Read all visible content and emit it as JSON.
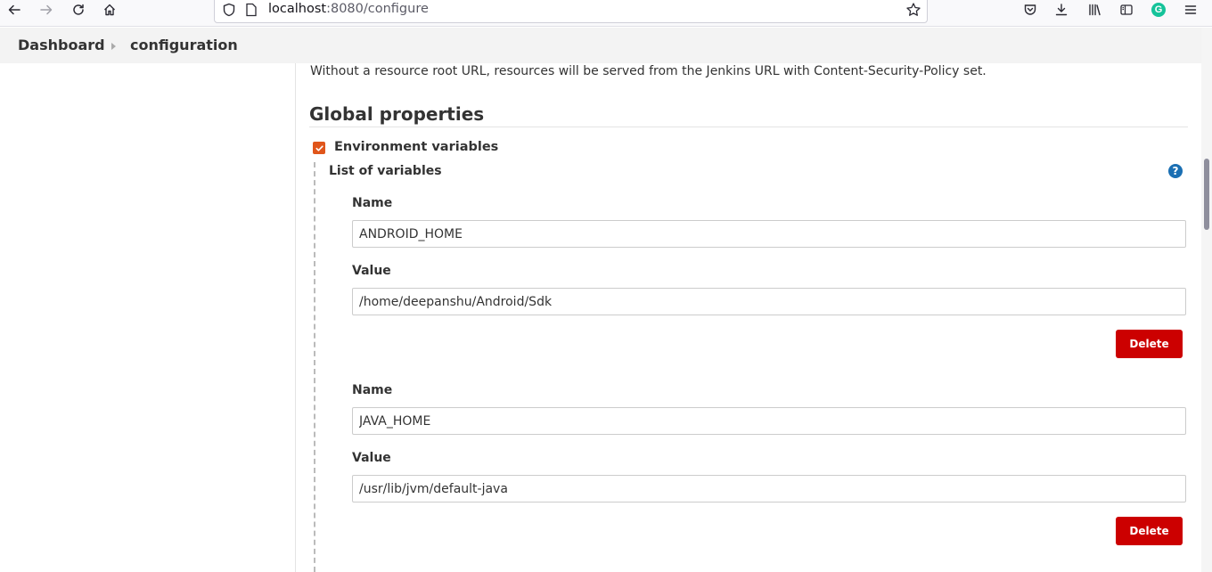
{
  "browser": {
    "url_host": "localhost",
    "url_rest": ":8080/configure"
  },
  "breadcrumb": {
    "items": [
      "Dashboard",
      "configuration"
    ]
  },
  "content": {
    "resource_info": "Without a resource root URL, resources will be served from the Jenkins URL with Content-Security-Policy set.",
    "section_title": "Global properties",
    "env_vars_label": "Environment variables",
    "env_vars_checked": true,
    "list_label": "List of variables",
    "help_glyph": "?",
    "variables": [
      {
        "name_label": "Name",
        "name": "ANDROID_HOME",
        "value_label": "Value",
        "value": "/home/deepanshu/Android/Sdk",
        "delete_label": "Delete"
      },
      {
        "name_label": "Name",
        "name": "JAVA_HOME",
        "value_label": "Value",
        "value": "/usr/lib/jvm/default-java",
        "delete_label": "Delete"
      }
    ]
  },
  "colors": {
    "accent_checkbox": "#e0561b",
    "delete_button": "#cc0000",
    "help_icon": "#1a6fb3"
  }
}
